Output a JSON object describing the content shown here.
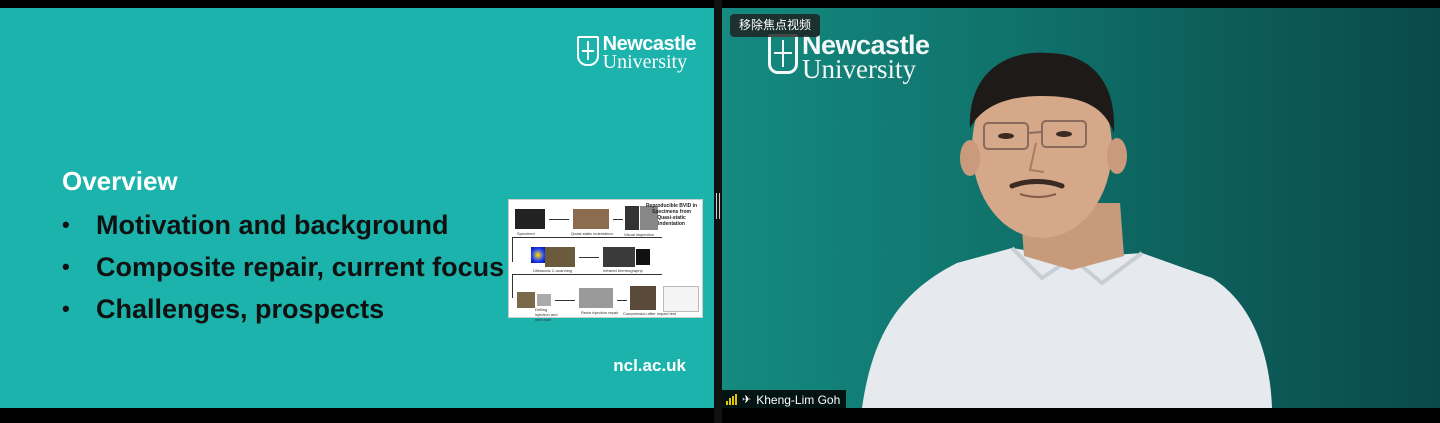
{
  "slide": {
    "logo": {
      "line1": "Newcastle",
      "line2": "University"
    },
    "title": "Overview",
    "bullets": [
      {
        "marker": "•",
        "text": "Motivation and background"
      },
      {
        "marker": "•",
        "text": "Composite repair, current focus"
      },
      {
        "marker": "•",
        "text": "Challenges, prospects"
      }
    ],
    "figure": {
      "note": "Reproducible BVID in Specimens from Quasi-static Indentation",
      "captions": [
        "Specimen",
        "Quasi-static indentation",
        "Visual inspection",
        "Ultrasonic C-scanning",
        "Infrared thermography",
        "Drilling injection and vent hole",
        "Resin injection repair",
        "Compression after impact test"
      ]
    },
    "footer": "ncl.ac.uk",
    "background_color": "#1bb3ab"
  },
  "video": {
    "logo": {
      "line1": "Newcastle",
      "line2": "University"
    },
    "remove_focus_label": "移除焦点视频",
    "participant_name": "Kheng-Lim Goh",
    "icons": {
      "signal": "signal-strength-icon",
      "pin": "pin-icon"
    }
  }
}
